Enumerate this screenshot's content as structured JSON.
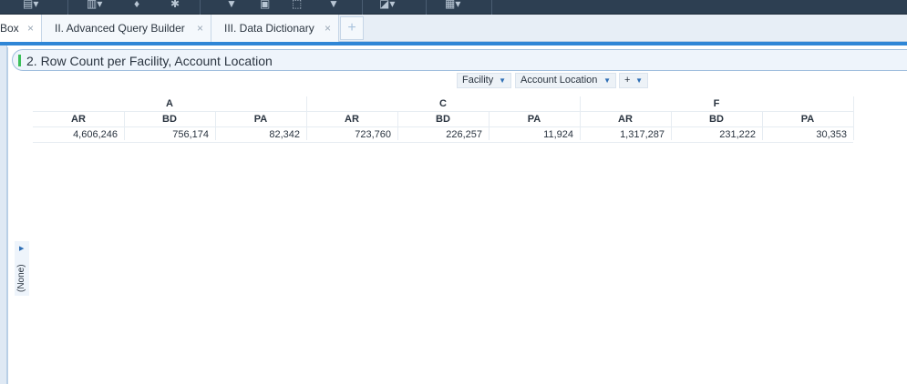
{
  "tabs": [
    {
      "label": "Box",
      "close": "×"
    },
    {
      "label": "II. Advanced Query Builder",
      "close": "×"
    },
    {
      "label": "III. Data Dictionary",
      "close": "×"
    }
  ],
  "tab_add": "+",
  "panel": {
    "title": "2. Row Count per Facility, Account Location"
  },
  "pivot_controls": {
    "facility": "Facility",
    "account_location": "Account Location",
    "add": "+"
  },
  "pivot": {
    "groups": [
      "A",
      "C",
      "F"
    ],
    "subheaders": [
      "AR",
      "BD",
      "PA",
      "AR",
      "BD",
      "PA",
      "AR",
      "BD",
      "PA"
    ],
    "values": [
      "4,606,246",
      "756,174",
      "82,342",
      "723,760",
      "226,257",
      "11,924",
      "1,317,287",
      "231,222",
      "30,353"
    ]
  },
  "side": {
    "label": "(None)"
  }
}
